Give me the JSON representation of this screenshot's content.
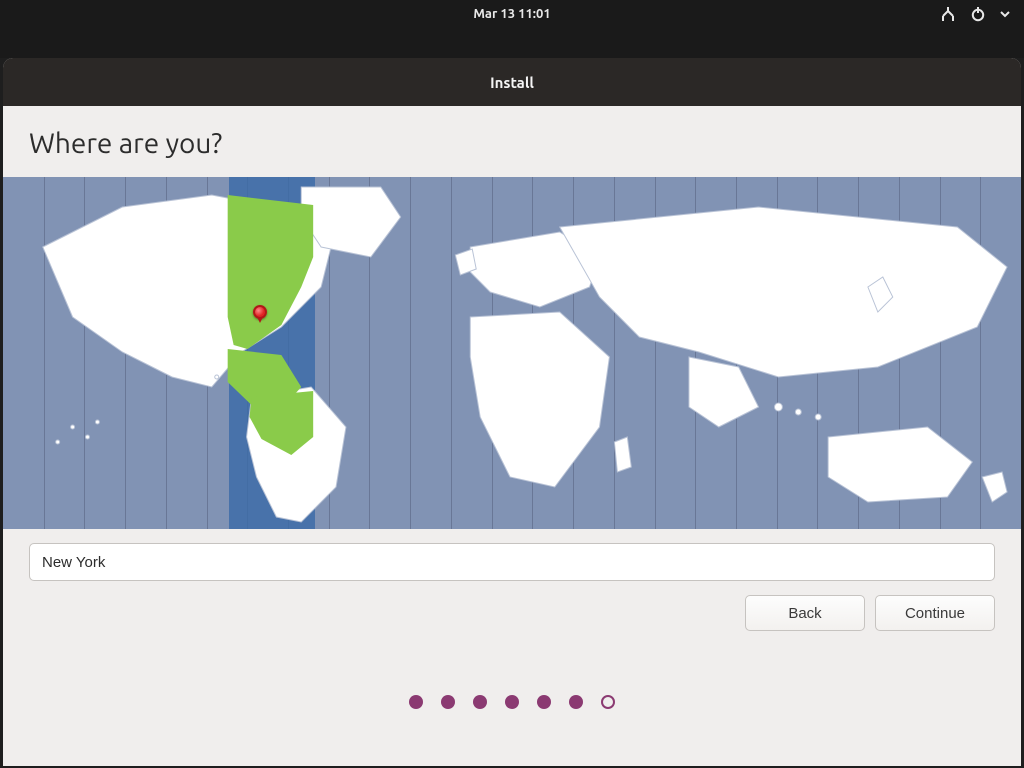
{
  "topbar": {
    "datetime": "Mar 13  11:01"
  },
  "window": {
    "title": "Install"
  },
  "page": {
    "heading": "Where are you?",
    "location_value": "New York",
    "buttons": {
      "back": "Back",
      "continue": "Continue"
    }
  },
  "steps": {
    "total": 7,
    "current": 6
  },
  "map": {
    "selected_timezone_highlight_color": "#3a6aa8",
    "selected_land_color": "#8acb4a",
    "pin_color": "#e02424",
    "ocean_color": "#8193b4"
  }
}
